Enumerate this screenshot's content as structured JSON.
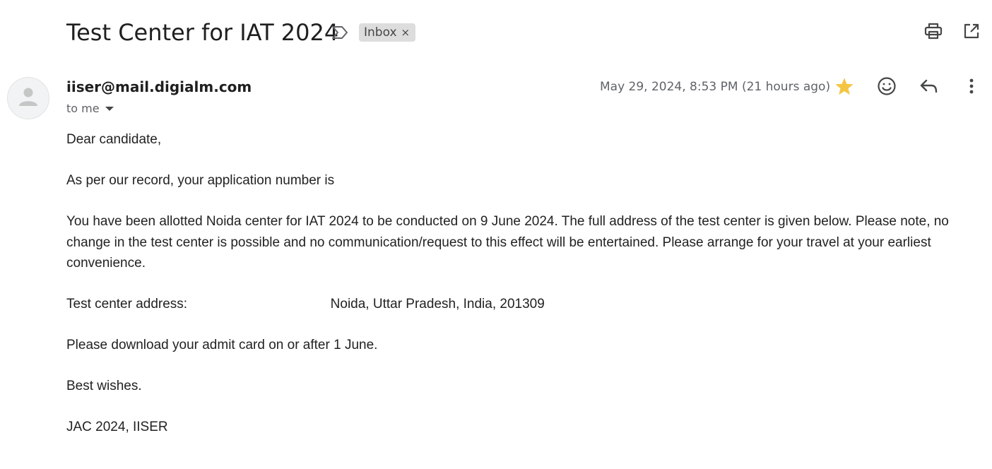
{
  "email": {
    "subject": "Test Center for IAT 2024",
    "label_chip": "Inbox",
    "label_remove": "×",
    "sender": "iiser@mail.digialm.com",
    "recipient_line": "to me",
    "date": "May 29, 2024, 8:53 PM (21 hours ago)",
    "starred": true,
    "star_color": "#f4c542",
    "icons": {
      "important": "importance-marker-icon",
      "print": "print-icon",
      "open_new_window": "open-in-new-window-icon",
      "avatar": "default-person-icon",
      "star": "star-icon",
      "emoji": "emoji-reaction-icon",
      "reply": "reply-icon",
      "more": "more-vertical-icon"
    },
    "body": {
      "greeting": "Dear candidate,",
      "application_line": "As per our record, your application number is",
      "allotment_paragraph": "You have been allotted Noida center for IAT 2024 to be conducted on 9 June 2024. The full address of the test center is given below. Please note, no change in the test center is possible and no communication/request to this effect will be entertained. Please arrange for your travel at your earliest convenience.",
      "address_label": "Test center address:",
      "address_suffix": "Noida, Uttar Pradesh, India, 201309",
      "admit_card_line": "Please download your admit card on or after 1 June.",
      "closing": "Best wishes.",
      "signature": "JAC 2024, IISER"
    }
  }
}
